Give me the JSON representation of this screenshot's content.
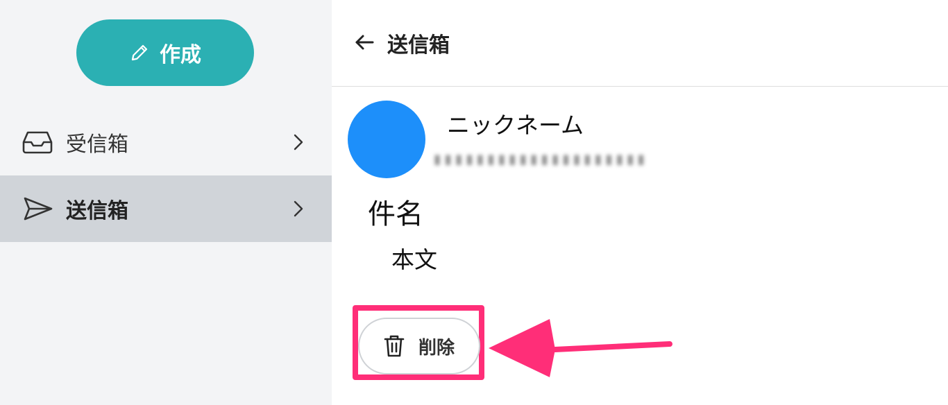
{
  "sidebar": {
    "compose_label": "作成",
    "items": [
      {
        "label": "受信箱",
        "icon": "inbox-icon"
      },
      {
        "label": "送信箱",
        "icon": "send-icon",
        "active": true
      }
    ]
  },
  "header": {
    "title": "送信箱"
  },
  "message": {
    "sender_name": "ニックネーム",
    "subject": "件名",
    "body": "本文"
  },
  "actions": {
    "delete_label": "削除"
  },
  "colors": {
    "accent": "#2bb0b3",
    "avatar": "#1d8ffa",
    "active_nav": "#d0d4d9",
    "highlight": "#ff2e78"
  }
}
